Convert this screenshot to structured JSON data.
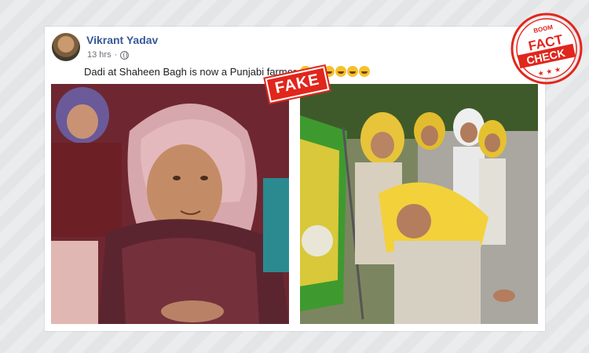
{
  "post": {
    "author": "Vikrant Yadav",
    "timestamp": "13 hrs",
    "privacy_icon": "globe-icon",
    "text": "Dadi at Shaheen Bagh is now a Punjabi farmer",
    "emoji_count": 6
  },
  "stamp": {
    "label": "FAKE"
  },
  "badge": {
    "brand": "BOOM",
    "line1": "FACT",
    "line2": "CHECK",
    "stars": "★ ★ ★"
  },
  "colors": {
    "author_link": "#385898",
    "stamp_red": "#e1261c",
    "badge_red": "#e1261c"
  }
}
